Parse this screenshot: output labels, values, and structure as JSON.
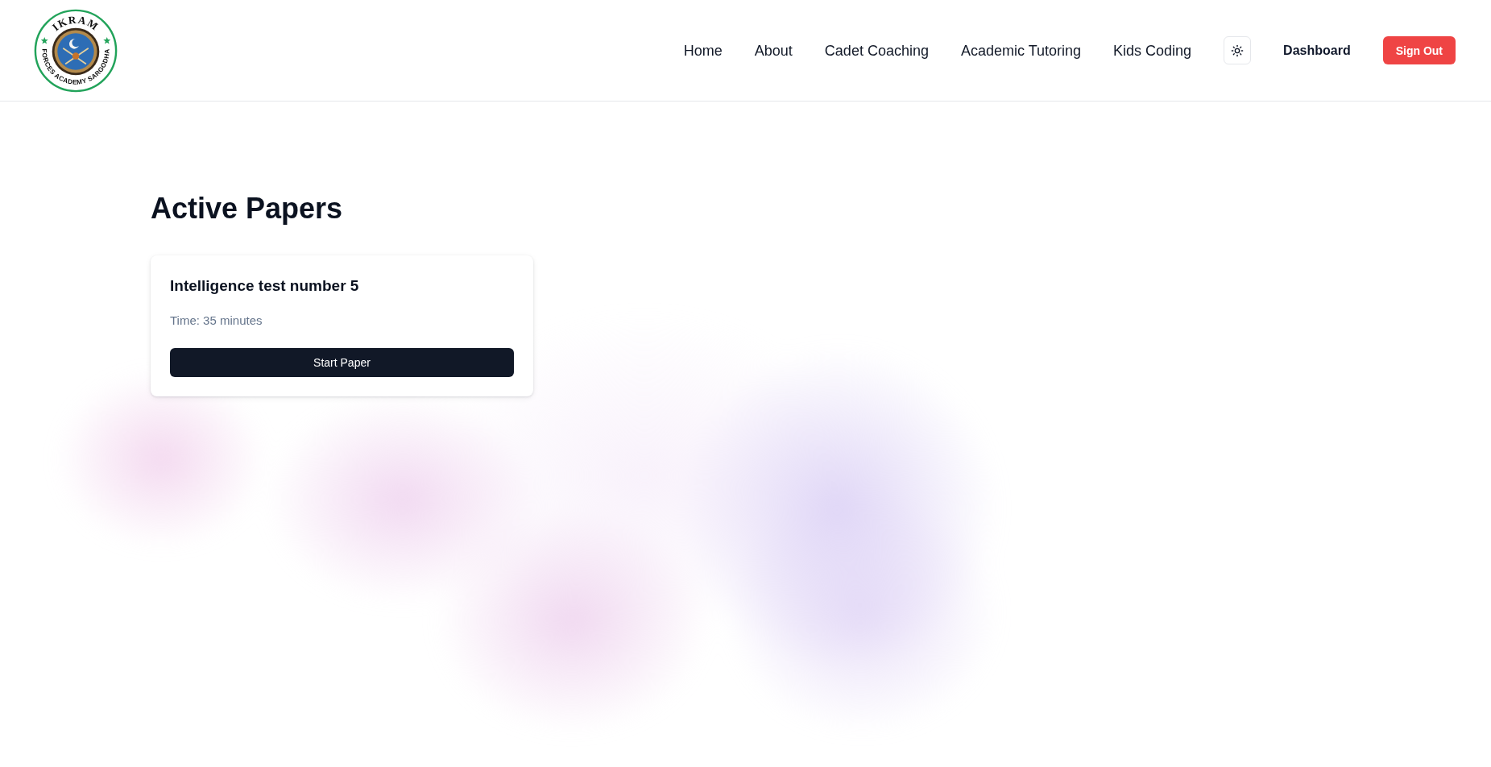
{
  "header": {
    "logo": {
      "title": "IKRAM",
      "subtitle": "FORCES ACADEMY SARGODHA"
    },
    "nav_links": [
      "Home",
      "About",
      "Cadet Coaching",
      "Academic Tutoring",
      "Kids Coding"
    ],
    "dashboard_link": "Dashboard",
    "sign_out_button": "Sign Out"
  },
  "page_title": "Active Papers",
  "papers": [
    {
      "title": "Intelligence test number 5",
      "time": "Time: 35 minutes",
      "button": "Start Paper"
    }
  ]
}
